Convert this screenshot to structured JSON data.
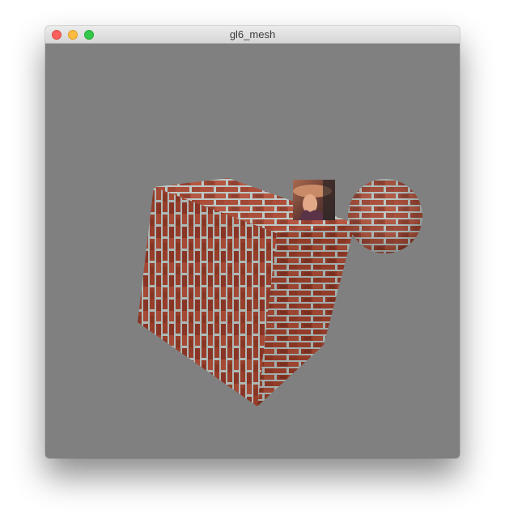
{
  "window": {
    "title": "gl6_mesh"
  },
  "titlebar": {
    "buttons": [
      "close-button",
      "minimize-button",
      "zoom-button"
    ],
    "colors": {
      "close": "#fc605c",
      "minimize": "#fdbc40",
      "zoom": "#34c84a"
    }
  },
  "scene": {
    "background_color": "#808080",
    "objects": [
      "brick-textured-cube",
      "portrait-textured-quad",
      "brick-textured-sphere"
    ],
    "brick_color": "#a8452f",
    "mortar_color": "#b9c7c4"
  }
}
